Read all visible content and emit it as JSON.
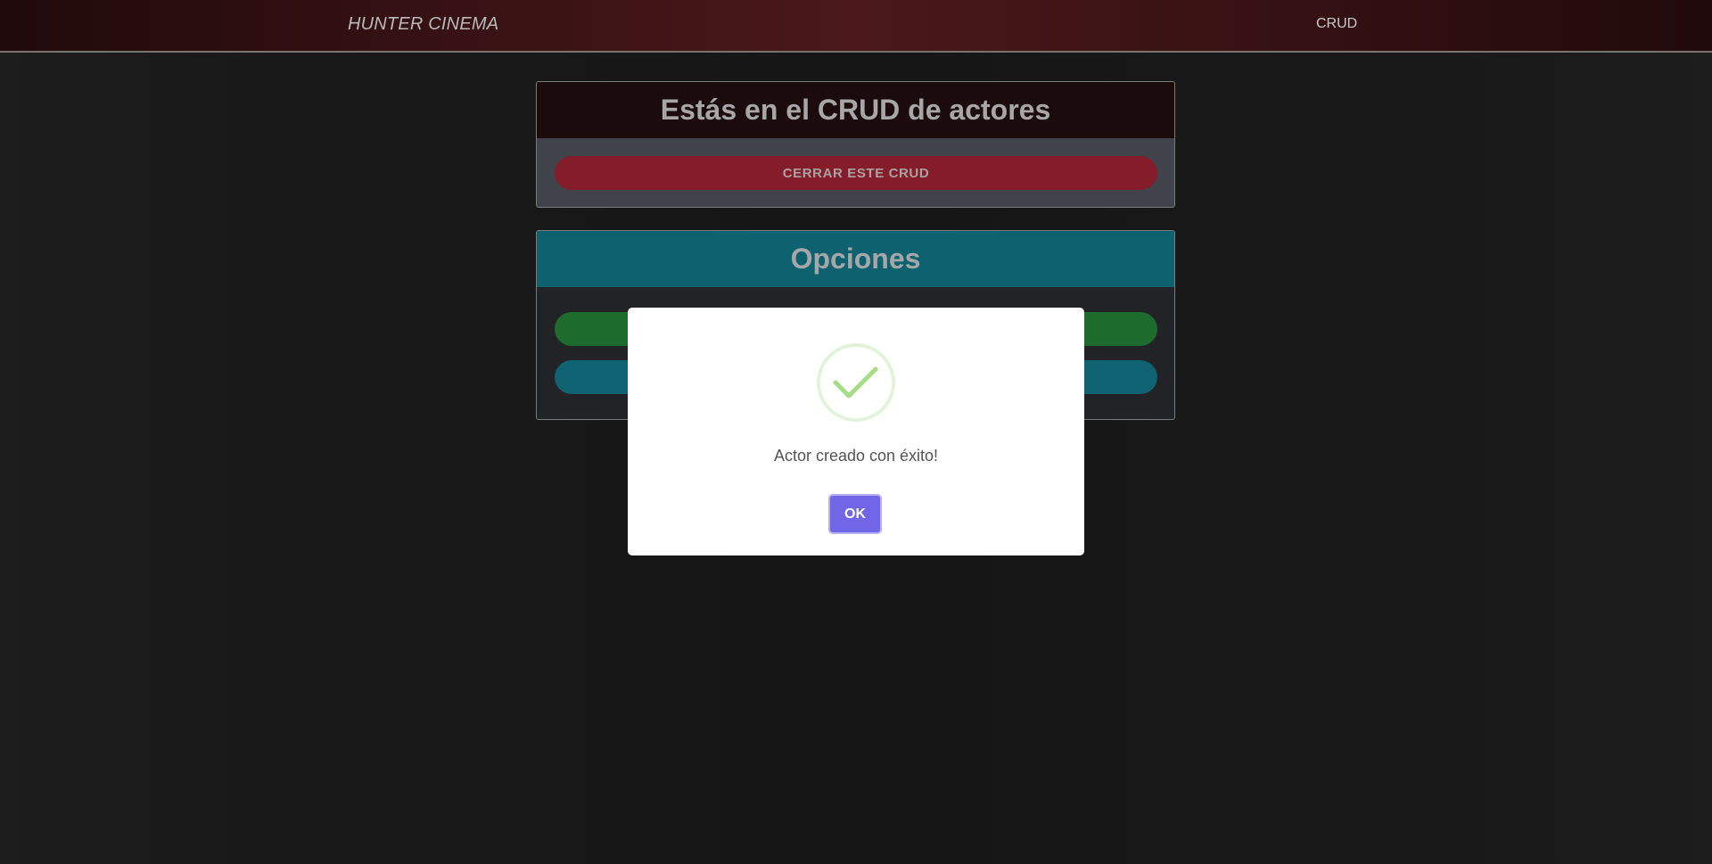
{
  "navbar": {
    "brand": "HUNTER CINEMA",
    "link": "CRUD"
  },
  "crud_card": {
    "title": "Estás en el CRUD de actores",
    "close_label": "CERRAR ESTE CRUD"
  },
  "options_card": {
    "title": "Opciones"
  },
  "modal": {
    "icon": "check-icon",
    "message": "Actor creado con éxito!",
    "ok_label": "OK"
  },
  "colors": {
    "navbar_accent": "#4a181a",
    "danger": "#841c2a",
    "success": "#1e6b2e",
    "info": "#0e6272",
    "confirm": "#7266e8",
    "check": "#a5dc86"
  }
}
